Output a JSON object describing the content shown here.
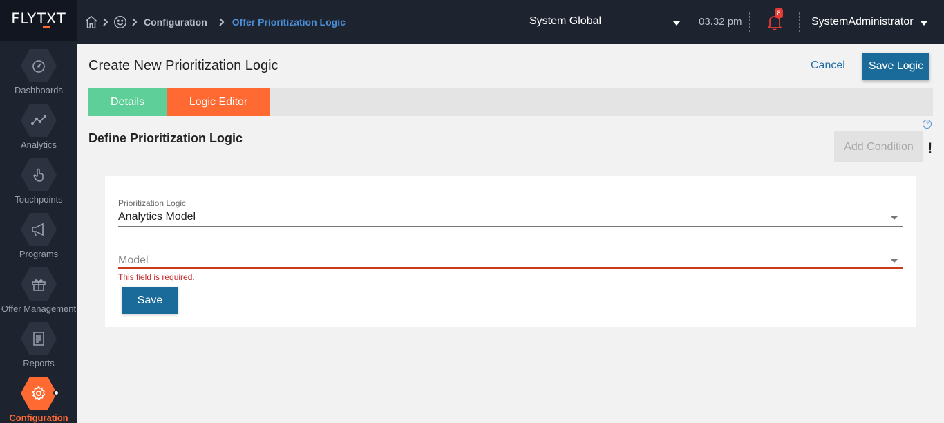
{
  "brand": {
    "logo_text": "FLYTXT",
    "accent": "#ff6a33"
  },
  "header": {
    "breadcrumb": {
      "home_icon": "home-icon",
      "face_icon": "smiley-icon",
      "items": [
        "Configuration",
        "Offer Prioritization Logic"
      ]
    },
    "context_selector": "System Global",
    "time": "03.32 pm",
    "notifications": {
      "icon": "bell-icon",
      "count": "8"
    },
    "user": "SystemAdministrator"
  },
  "sidebar": {
    "items": [
      {
        "label": "Dashboards",
        "icon": "dashboard-gauge-icon"
      },
      {
        "label": "Analytics",
        "icon": "analytics-line-icon"
      },
      {
        "label": "Touchpoints",
        "icon": "touch-hand-icon"
      },
      {
        "label": "Programs",
        "icon": "megaphone-icon"
      },
      {
        "label": "Offer Management",
        "icon": "gift-icon"
      },
      {
        "label": "Reports",
        "icon": "report-document-icon"
      },
      {
        "label": "Configuration",
        "icon": "gear-icon",
        "active": true
      }
    ]
  },
  "page": {
    "title": "Create New Prioritization Logic",
    "cancel_label": "Cancel",
    "save_logic_label": "Save Logic",
    "tabs": [
      {
        "label": "Details",
        "color": "#5fcf99"
      },
      {
        "label": "Logic Editor",
        "color": "#ff6a33",
        "active": true
      }
    ],
    "section_title": "Define Prioritization Logic",
    "add_condition_label": "Add Condition",
    "help_icon": "help-circle-icon",
    "warning_icon": "exclamation-icon"
  },
  "form": {
    "prioritization_logic": {
      "label": "Prioritization Logic",
      "value": "Analytics Model"
    },
    "model": {
      "placeholder": "Model",
      "error": "This field is required."
    },
    "save_label": "Save"
  }
}
